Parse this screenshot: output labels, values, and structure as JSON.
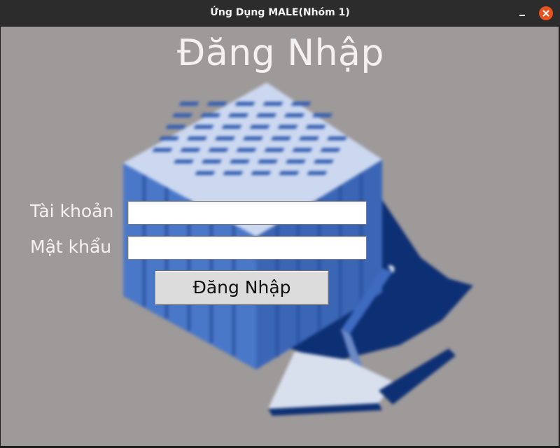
{
  "window": {
    "title": "Ứng Dụng MALE(Nhóm 1)"
  },
  "controls": {
    "minimize_icon": "minimize-icon",
    "close_icon": "close-icon",
    "close_color": "#e9531f"
  },
  "login": {
    "heading": "Đăng Nhập",
    "username_label": "Tài khoản",
    "password_label": "Mật khẩu",
    "username_value": "",
    "password_value": "",
    "submit_label": "Đăng Nhập"
  },
  "background": {
    "illustration": "brick-and-trowel-illustration",
    "colors": {
      "canvas": "#9e9a9a",
      "brick": "#4a78c8",
      "shadow": "#0d2f73",
      "trowel": "#d8e0ee"
    }
  }
}
